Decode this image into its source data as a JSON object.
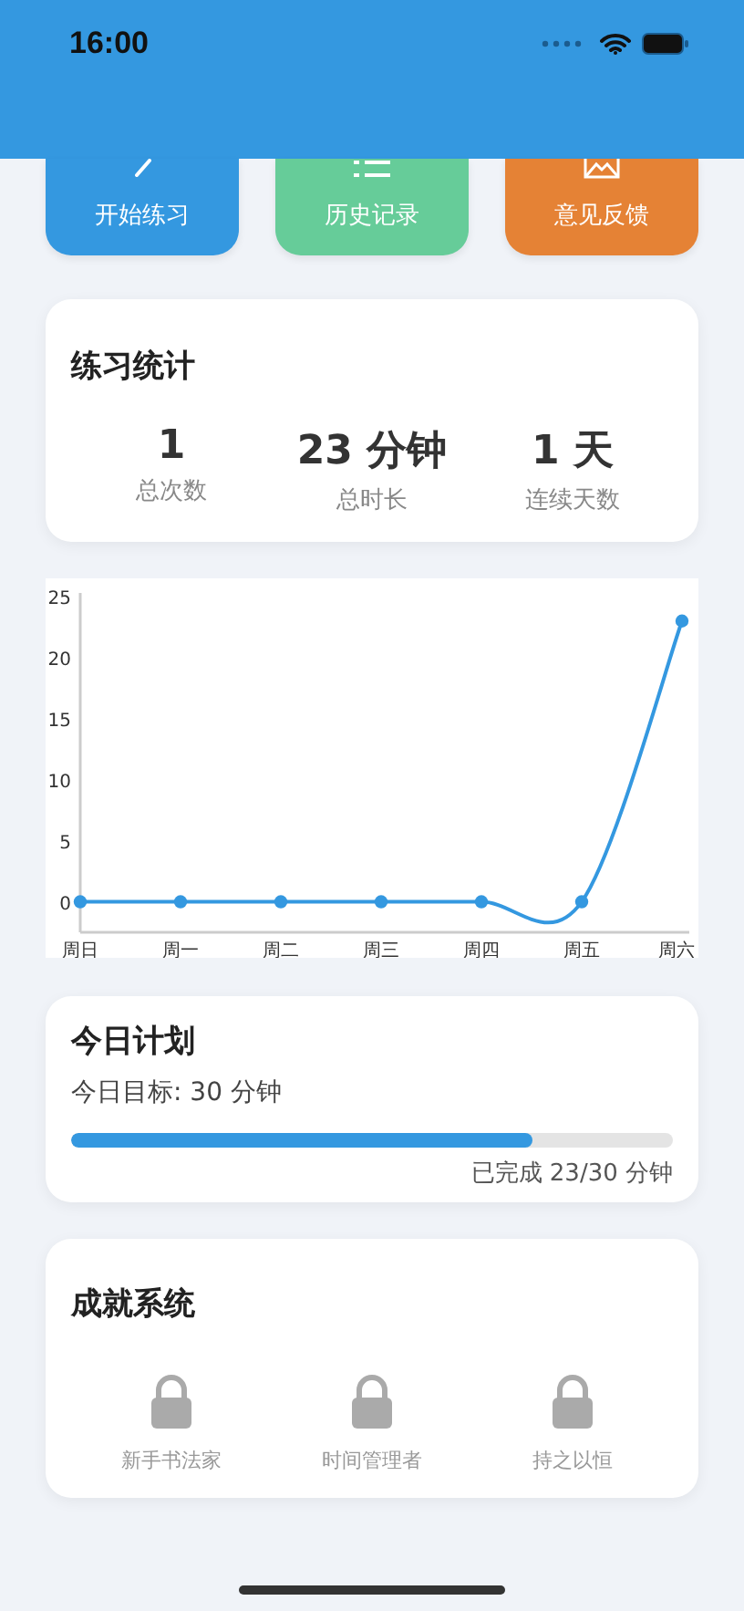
{
  "status_bar": {
    "time": "16:00"
  },
  "actions": [
    {
      "label": "开始练习",
      "kind": "pencil",
      "color": "#3498e0"
    },
    {
      "label": "历史记录",
      "kind": "list",
      "color": "#66cc99"
    },
    {
      "label": "意见反馈",
      "kind": "mail",
      "color": "#e58235"
    }
  ],
  "stats": {
    "title": "练习统计",
    "items": [
      {
        "value": "1",
        "label": "总次数"
      },
      {
        "value": "23 分钟",
        "label": "总时长"
      },
      {
        "value": "1 天",
        "label": "连续天数"
      }
    ]
  },
  "chart_data": {
    "type": "line",
    "categories": [
      "周日",
      "周一",
      "周二",
      "周三",
      "周四",
      "周五",
      "周六"
    ],
    "series": [
      {
        "color": "#3498e0",
        "marker": "circle",
        "values": [
          0,
          0,
          0,
          0,
          0,
          0,
          23
        ]
      }
    ],
    "ylim": [
      -2.5,
      25.3
    ],
    "yticks": [
      0,
      5,
      10,
      15,
      20,
      25
    ]
  },
  "plan": {
    "title": "今日计划",
    "goal": "今日目标: 30 分钟",
    "level": 0.767,
    "progress_text": "已完成 23/30 分钟"
  },
  "achievements": {
    "title": "成就系统",
    "items": [
      {
        "label": "新手书法家",
        "unlocked": false
      },
      {
        "label": "时间管理者",
        "unlocked": false
      },
      {
        "label": "持之以恒",
        "unlocked": false
      }
    ]
  }
}
